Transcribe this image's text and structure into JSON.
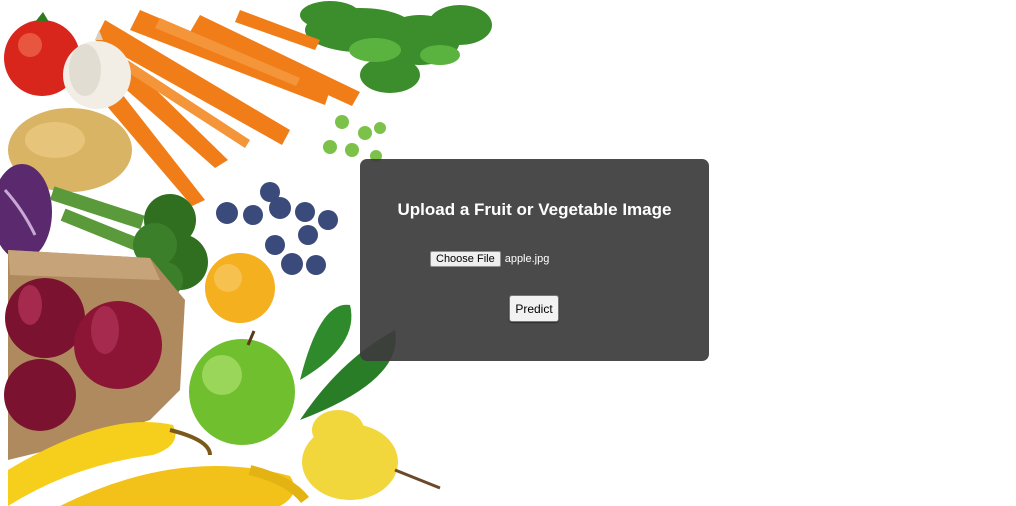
{
  "upload_form": {
    "title": "Upload a Fruit or Vegetable Image",
    "choose_file_label": "Choose File",
    "selected_file_name": "apple.jpg",
    "predict_label": "Predict"
  },
  "background": {
    "description_icon": "fruits-vegetables-photo-icon"
  },
  "colors": {
    "panel_background": "#3c3c3c",
    "panel_text": "#ffffff",
    "page_background": "#ffffff"
  }
}
